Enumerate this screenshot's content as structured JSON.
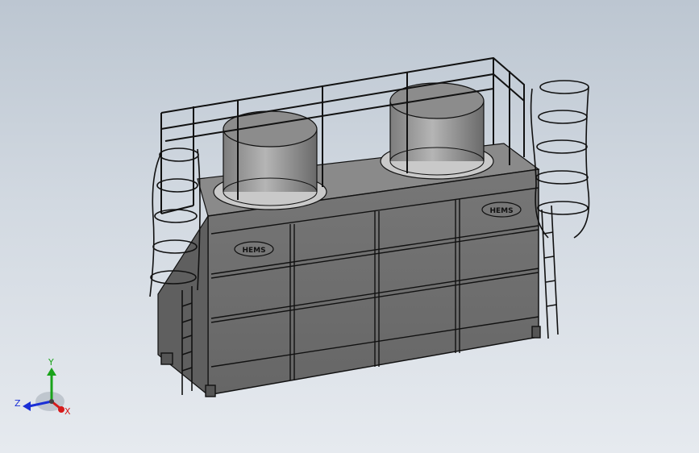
{
  "viewport": {
    "background_top": "#bcc6d1",
    "background_bottom": "#e6eaef"
  },
  "model": {
    "name": "cooling-tower-assembly",
    "nameplate_text": "HEMS",
    "body_color": "#6e6e6e",
    "edge_color": "#111111",
    "fan_color": "#9a9a9a"
  },
  "triad": {
    "x_label": "X",
    "y_label": "Y",
    "z_label": "Z",
    "x_color": "#d61a1a",
    "y_color": "#1aa31a",
    "z_color": "#1a2fd6"
  }
}
